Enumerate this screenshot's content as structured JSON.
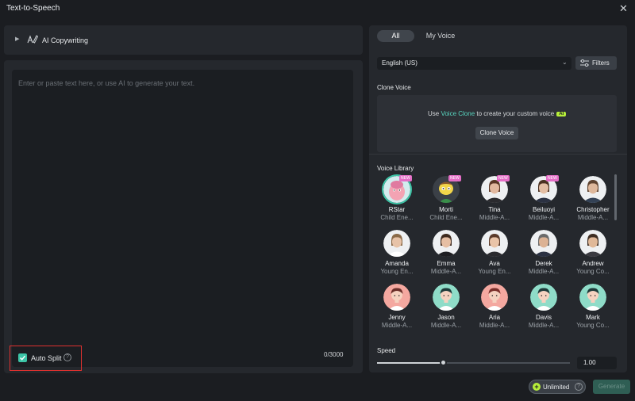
{
  "window": {
    "title": "Text-to-Speech",
    "close_symbol": "✕"
  },
  "copywriting": {
    "label": "AI Copywriting"
  },
  "editor": {
    "placeholder": "Enter or paste text here, or use AI to generate your text.",
    "counter": "0/3000"
  },
  "auto_split": {
    "label": "Auto Split",
    "checked": true,
    "help": "?"
  },
  "tabs": {
    "all": "All",
    "my_voice": "My Voice"
  },
  "language": {
    "selected": "English (US)"
  },
  "filters": {
    "label": "Filters"
  },
  "clone": {
    "section_label": "Clone Voice",
    "text_before": "Use ",
    "link": "Voice Clone",
    "text_after": " to create your custom voice",
    "ai_badge": "AI",
    "button": "Clone Voice"
  },
  "library": {
    "section_label": "Voice Library",
    "new_badge": "NEW",
    "voices": [
      {
        "name": "RStar",
        "desc": "Child Ene...",
        "new": true,
        "selected": true,
        "kind": "pink-char",
        "skin": "#f3a3b3",
        "hair": "#e07aa0",
        "bg": "#d2ecee"
      },
      {
        "name": "Morti",
        "desc": "Child Ene...",
        "new": true,
        "kind": "yellow-char",
        "skin": "#f2d54a",
        "hair": "#8a5a2b",
        "bg": "#3b4047"
      },
      {
        "name": "Tina",
        "desc": "Middle-A...",
        "new": true,
        "kind": "photo",
        "skin": "#e2b9a0",
        "hair": "#5a3626",
        "shirt": "#2a2a2e",
        "bg": "#eef0f2"
      },
      {
        "name": "Beiluoyi",
        "desc": "Middle-A...",
        "new": true,
        "kind": "photo",
        "skin": "#e3bea4",
        "hair": "#4a3020",
        "shirt": "#2b3142",
        "bg": "#eef0f2"
      },
      {
        "name": "Christopher",
        "desc": "Middle-A...",
        "kind": "photo",
        "skin": "#deb89c",
        "hair": "#5e4330",
        "shirt": "#334155",
        "bg": "#eef0f2"
      },
      {
        "name": "Amanda",
        "desc": "Young En...",
        "kind": "photo",
        "skin": "#e7c3a8",
        "hair": "#8a6a48",
        "shirt": "#ffffff",
        "bg": "#eef0f2"
      },
      {
        "name": "Emma",
        "desc": "Middle-A...",
        "kind": "photo",
        "skin": "#e6bfa4",
        "hair": "#3e2a1e",
        "shirt": "#1e1e22",
        "bg": "#eef0f2"
      },
      {
        "name": "Ava",
        "desc": "Young En...",
        "kind": "photo",
        "skin": "#e9c4a8",
        "hair": "#5a3a2a",
        "shirt": "#2a2a2e",
        "bg": "#eef0f2"
      },
      {
        "name": "Derek",
        "desc": "Middle-A...",
        "kind": "photo",
        "skin": "#dcb294",
        "hair": "#6b6b6b",
        "shirt": "#2b3142",
        "bg": "#eef0f2"
      },
      {
        "name": "Andrew",
        "desc": "Young Co...",
        "kind": "photo",
        "skin": "#e0b898",
        "hair": "#3e2d22",
        "shirt": "#3a3a40",
        "bg": "#eef0f2"
      },
      {
        "name": "Jenny",
        "desc": "Middle-A...",
        "kind": "cartoon",
        "skin": "#f5d2c0",
        "hair": "#6a2f2a",
        "shirt": "#ffffff",
        "bg": "#f4a8a0"
      },
      {
        "name": "Jason",
        "desc": "Middle-A...",
        "kind": "cartoon",
        "skin": "#f5d2c0",
        "hair": "#1e3a3a",
        "shirt": "#ffffff",
        "bg": "#8fdcc8"
      },
      {
        "name": "Aria",
        "desc": "Middle-A...",
        "kind": "cartoon",
        "skin": "#f5d2c0",
        "hair": "#7a2f2a",
        "shirt": "#ffffff",
        "bg": "#f4a8a0"
      },
      {
        "name": "Davis",
        "desc": "Middle-A...",
        "kind": "cartoon",
        "skin": "#f5d2c0",
        "hair": "#1e3a3a",
        "shirt": "#ffffff",
        "bg": "#8fdcc8"
      },
      {
        "name": "Mark",
        "desc": "Young Co...",
        "kind": "cartoon",
        "skin": "#f5d2c0",
        "hair": "#1e3a3a",
        "shirt": "#ffffff",
        "bg": "#8fdcc8"
      }
    ]
  },
  "speed": {
    "label": "Speed",
    "value": "1.00",
    "fraction": 0.34
  },
  "footer": {
    "unlimited": "Unlimited",
    "help": "?",
    "generate": "Generate"
  },
  "colors": {
    "accent": "#3cc5a7",
    "link": "#58d5bf",
    "ai_badge": "#b7ef3a",
    "new_badge": "#e46ec6",
    "highlight": "#e0312f"
  }
}
